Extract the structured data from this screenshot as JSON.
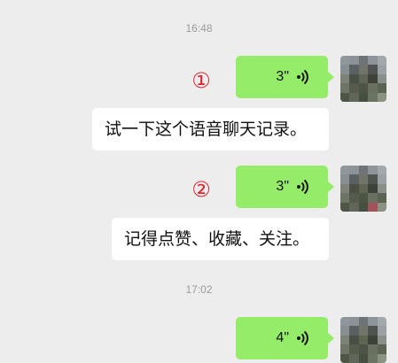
{
  "chat": {
    "timestamps": [
      "16:48",
      "17:02"
    ],
    "messages": [
      {
        "marker": "①",
        "voice_duration": "3\"",
        "caption": "试一下这个语音聊天记录。"
      },
      {
        "marker": "②",
        "voice_duration": "3\"",
        "caption": "记得点赞、收藏、关注。"
      },
      {
        "voice_duration": "4\""
      }
    ]
  },
  "colors": {
    "background": "#ededed",
    "voice_bubble": "#95ec69",
    "text_bubble": "#ffffff",
    "marker": "#e0242f",
    "timestamp": "#9b9b9b"
  },
  "icons": {
    "voice": "voice-wave-icon",
    "avatar": "pixelated-avatar"
  }
}
